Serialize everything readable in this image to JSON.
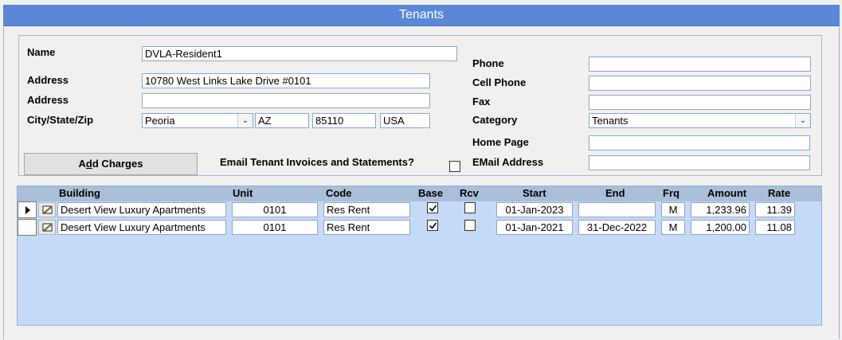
{
  "window": {
    "title": "Tenants"
  },
  "form": {
    "name_label": "Name",
    "name_value": "DVLA-Resident1",
    "address_label": "Address",
    "address1_value": "10780 West Links Lake Drive  #0101",
    "address2_label": "Address",
    "address2_value": "",
    "csz_label": "City/State/Zip",
    "city_value": "Peoria",
    "state_value": "AZ",
    "zip_value": "85110",
    "country_value": "USA",
    "phone_label": "Phone",
    "phone_value": "",
    "cell_label": "Cell Phone",
    "cell_value": "",
    "fax_label": "Fax",
    "fax_value": "",
    "category_label": "Category",
    "category_value": "Tenants",
    "homepage_label": "Home Page",
    "homepage_value": "",
    "email_label": "EMail Address",
    "email_value": "",
    "email_invoices_label": "Email Tenant Invoices and Statements?",
    "email_invoices_checked": false,
    "add_charges_pre": "A",
    "add_charges_mnemonic": "d",
    "add_charges_post": "d Charges"
  },
  "grid": {
    "headers": {
      "building": "Building",
      "unit": "Unit",
      "code": "Code",
      "base": "Base",
      "rcv": "Rcv",
      "start": "Start",
      "end": "End",
      "frq": "Frq",
      "amount": "Amount",
      "rate": "Rate"
    },
    "rows": [
      {
        "building": "Desert View Luxury Apartments",
        "unit": "0101",
        "code": "Res Rent",
        "base": true,
        "rcv": false,
        "start": "01-Jan-2023",
        "end": "",
        "frq": "M",
        "amount": "1,233.96",
        "rate": "11.39"
      },
      {
        "building": "Desert View Luxury Apartments",
        "unit": "0101",
        "code": "Res Rent",
        "base": true,
        "rcv": false,
        "start": "01-Jan-2021",
        "end": "31-Dec-2022",
        "frq": "M",
        "amount": "1,200.00",
        "rate": "11.08"
      }
    ]
  }
}
